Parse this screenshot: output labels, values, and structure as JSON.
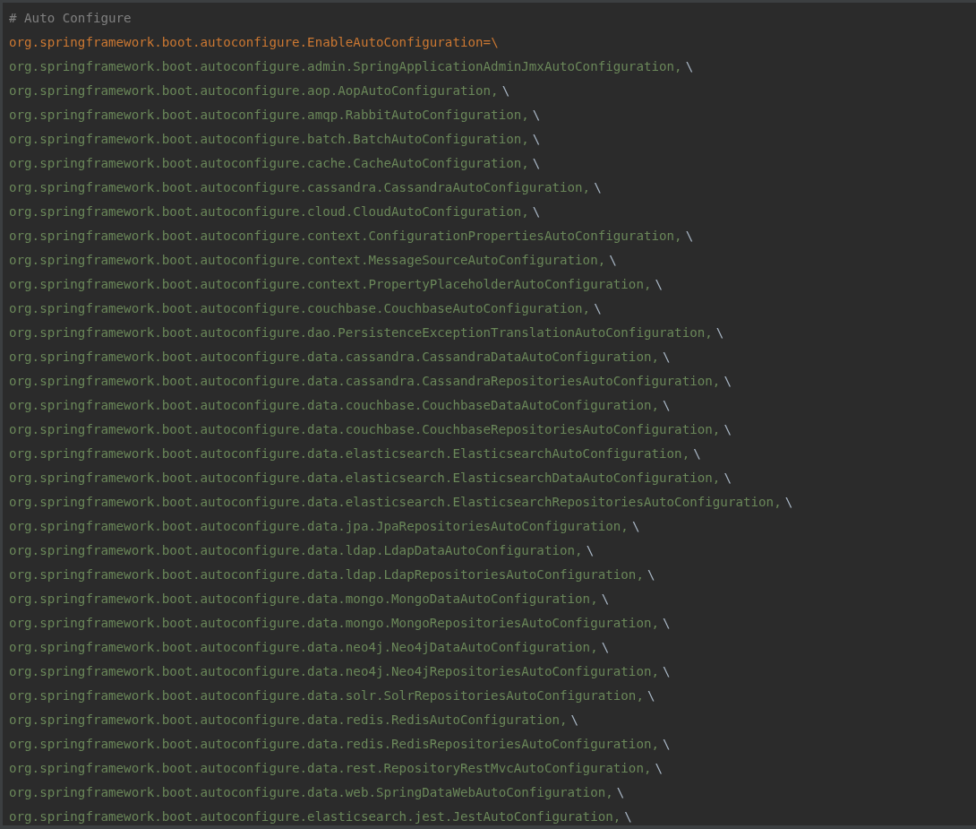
{
  "comment": "# Auto Configure",
  "lines": [
    {
      "kind": "key",
      "text": "org.springframework.boot.autoconfigure.EnableAutoConfiguration=",
      "continuation": "\\"
    },
    {
      "kind": "value",
      "text": "org.springframework.boot.autoconfigure.admin.SpringApplicationAdminJmxAutoConfiguration,",
      "continuation": "\\"
    },
    {
      "kind": "value",
      "text": "org.springframework.boot.autoconfigure.aop.AopAutoConfiguration,",
      "continuation": "\\"
    },
    {
      "kind": "value",
      "text": "org.springframework.boot.autoconfigure.amqp.RabbitAutoConfiguration,",
      "continuation": "\\"
    },
    {
      "kind": "value",
      "text": "org.springframework.boot.autoconfigure.batch.BatchAutoConfiguration,",
      "continuation": "\\"
    },
    {
      "kind": "value",
      "text": "org.springframework.boot.autoconfigure.cache.CacheAutoConfiguration,",
      "continuation": "\\"
    },
    {
      "kind": "value",
      "text": "org.springframework.boot.autoconfigure.cassandra.CassandraAutoConfiguration,",
      "continuation": "\\"
    },
    {
      "kind": "value",
      "text": "org.springframework.boot.autoconfigure.cloud.CloudAutoConfiguration,",
      "continuation": "\\"
    },
    {
      "kind": "value",
      "text": "org.springframework.boot.autoconfigure.context.ConfigurationPropertiesAutoConfiguration,",
      "continuation": "\\"
    },
    {
      "kind": "value",
      "text": "org.springframework.boot.autoconfigure.context.MessageSourceAutoConfiguration,",
      "continuation": "\\"
    },
    {
      "kind": "value",
      "text": "org.springframework.boot.autoconfigure.context.PropertyPlaceholderAutoConfiguration,",
      "continuation": "\\"
    },
    {
      "kind": "value",
      "text": "org.springframework.boot.autoconfigure.couchbase.CouchbaseAutoConfiguration,",
      "continuation": "\\"
    },
    {
      "kind": "value",
      "text": "org.springframework.boot.autoconfigure.dao.PersistenceExceptionTranslationAutoConfiguration,",
      "continuation": "\\"
    },
    {
      "kind": "value",
      "text": "org.springframework.boot.autoconfigure.data.cassandra.CassandraDataAutoConfiguration,",
      "continuation": "\\"
    },
    {
      "kind": "value",
      "text": "org.springframework.boot.autoconfigure.data.cassandra.CassandraRepositoriesAutoConfiguration,",
      "continuation": "\\"
    },
    {
      "kind": "value",
      "text": "org.springframework.boot.autoconfigure.data.couchbase.CouchbaseDataAutoConfiguration,",
      "continuation": "\\"
    },
    {
      "kind": "value",
      "text": "org.springframework.boot.autoconfigure.data.couchbase.CouchbaseRepositoriesAutoConfiguration,",
      "continuation": "\\"
    },
    {
      "kind": "value",
      "text": "org.springframework.boot.autoconfigure.data.elasticsearch.ElasticsearchAutoConfiguration,",
      "continuation": "\\"
    },
    {
      "kind": "value",
      "text": "org.springframework.boot.autoconfigure.data.elasticsearch.ElasticsearchDataAutoConfiguration,",
      "continuation": "\\"
    },
    {
      "kind": "value",
      "text": "org.springframework.boot.autoconfigure.data.elasticsearch.ElasticsearchRepositoriesAutoConfiguration,",
      "continuation": "\\"
    },
    {
      "kind": "value",
      "text": "org.springframework.boot.autoconfigure.data.jpa.JpaRepositoriesAutoConfiguration,",
      "continuation": "\\"
    },
    {
      "kind": "value",
      "text": "org.springframework.boot.autoconfigure.data.ldap.LdapDataAutoConfiguration,",
      "continuation": "\\"
    },
    {
      "kind": "value",
      "text": "org.springframework.boot.autoconfigure.data.ldap.LdapRepositoriesAutoConfiguration,",
      "continuation": "\\"
    },
    {
      "kind": "value",
      "text": "org.springframework.boot.autoconfigure.data.mongo.MongoDataAutoConfiguration,",
      "continuation": "\\"
    },
    {
      "kind": "value",
      "text": "org.springframework.boot.autoconfigure.data.mongo.MongoRepositoriesAutoConfiguration,",
      "continuation": "\\"
    },
    {
      "kind": "value",
      "text": "org.springframework.boot.autoconfigure.data.neo4j.Neo4jDataAutoConfiguration,",
      "continuation": "\\"
    },
    {
      "kind": "value",
      "text": "org.springframework.boot.autoconfigure.data.neo4j.Neo4jRepositoriesAutoConfiguration,",
      "continuation": "\\"
    },
    {
      "kind": "value",
      "text": "org.springframework.boot.autoconfigure.data.solr.SolrRepositoriesAutoConfiguration,",
      "continuation": "\\"
    },
    {
      "kind": "value",
      "text": "org.springframework.boot.autoconfigure.data.redis.RedisAutoConfiguration,",
      "continuation": "\\"
    },
    {
      "kind": "value",
      "text": "org.springframework.boot.autoconfigure.data.redis.RedisRepositoriesAutoConfiguration,",
      "continuation": "\\"
    },
    {
      "kind": "value",
      "text": "org.springframework.boot.autoconfigure.data.rest.RepositoryRestMvcAutoConfiguration,",
      "continuation": "\\"
    },
    {
      "kind": "value",
      "text": "org.springframework.boot.autoconfigure.data.web.SpringDataWebAutoConfiguration,",
      "continuation": "\\"
    },
    {
      "kind": "value",
      "text": "org.springframework.boot.autoconfigure.elasticsearch.jest.JestAutoConfiguration,",
      "continuation": "\\"
    }
  ]
}
